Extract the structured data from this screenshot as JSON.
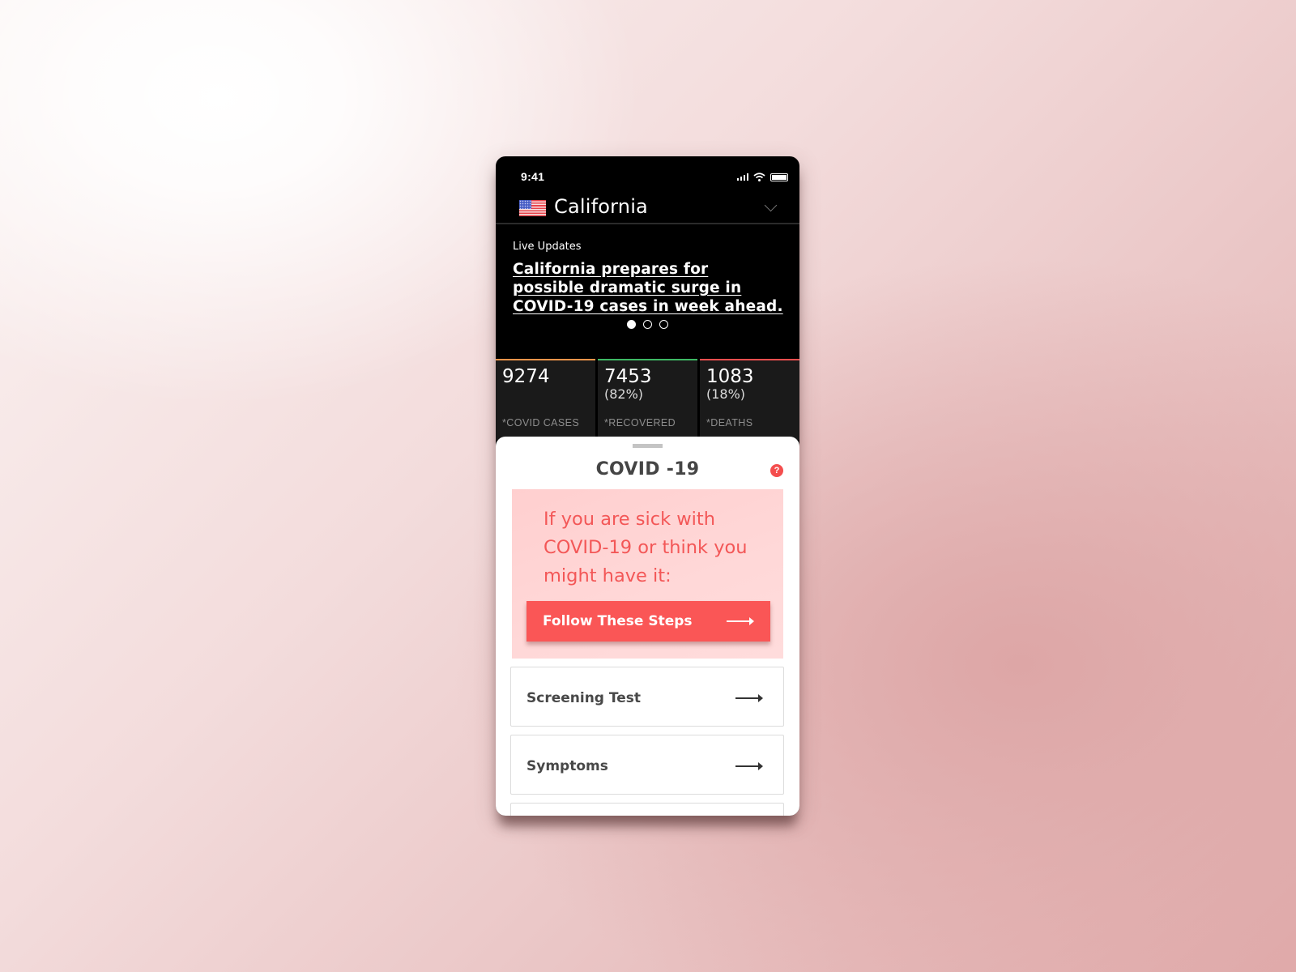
{
  "status_bar": {
    "time": "9:41",
    "icons": [
      "cellular-signal-icon",
      "wifi-icon",
      "battery-icon"
    ]
  },
  "location": {
    "flag_icon": "us-flag-icon",
    "name": "California",
    "dropdown_icon": "chevron-down-icon"
  },
  "news": {
    "label": "Live Updates",
    "headline": "California prepares for possible dramatic surge in COVID-19 cases in week ahead.",
    "carousel_total": 3,
    "carousel_active_index": 0
  },
  "stats": [
    {
      "value": "9274",
      "percent": "",
      "label": "*COVID CASES",
      "accent": "#f0944a"
    },
    {
      "value": "7453",
      "percent": "(82%)",
      "label": "*RECOVERED",
      "accent": "#3db864"
    },
    {
      "value": "1083",
      "percent": "(18%)",
      "label": "*DEATHS",
      "accent": "#f04e4e"
    }
  ],
  "sheet": {
    "title": "COVID -19",
    "help_icon": "?",
    "alert": {
      "text": "If you are sick with COVID-19 or think you might have it:",
      "button_label": "Follow These Steps"
    },
    "menu_items": [
      {
        "label": "Screening Test"
      },
      {
        "label": "Symptoms"
      },
      {
        "label": ""
      }
    ]
  },
  "colors": {
    "accent_red": "#fa5656",
    "alert_bg": "#ffd4d4",
    "alert_text": "#f35757"
  }
}
